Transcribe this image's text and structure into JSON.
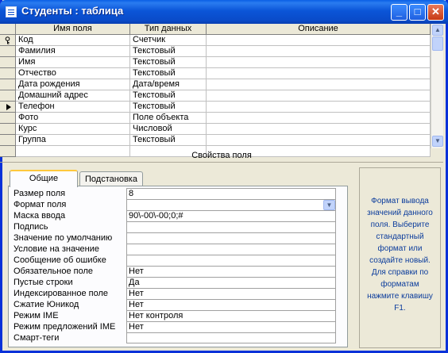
{
  "window": {
    "title": "Студенты : таблица",
    "minimize": "_",
    "maximize": "□",
    "close": "✕"
  },
  "grid": {
    "headers": [
      "Имя поля",
      "Тип данных",
      "Описание"
    ],
    "rows": [
      {
        "name": "Код",
        "type": "Счетчик",
        "desc": "",
        "marker": "key-icon"
      },
      {
        "name": "Фамилия",
        "type": "Текстовый",
        "desc": ""
      },
      {
        "name": "Имя",
        "type": "Текстовый",
        "desc": ""
      },
      {
        "name": "Отчество",
        "type": "Текстовый",
        "desc": ""
      },
      {
        "name": "Дата рождения",
        "type": "Дата/время",
        "desc": ""
      },
      {
        "name": "Домашний адрес",
        "type": "Текстовый",
        "desc": ""
      },
      {
        "name": "Телефон",
        "type": "Текстовый",
        "desc": "",
        "marker": "arrow-icon"
      },
      {
        "name": "Фото",
        "type": "Поле объекта",
        "desc": ""
      },
      {
        "name": "Курс",
        "type": "Числовой",
        "desc": ""
      },
      {
        "name": "Группа",
        "type": "Текстовый",
        "desc": ""
      }
    ]
  },
  "properties": {
    "label": "Свойства поля",
    "tabs": [
      "Общие",
      "Подстановка"
    ],
    "rows": [
      {
        "label": "Размер поля",
        "value": "8"
      },
      {
        "label": "Формат поля",
        "value": ""
      },
      {
        "label": "Маска ввода",
        "value": "90\\-00\\-00;0;#"
      },
      {
        "label": "Подпись",
        "value": ""
      },
      {
        "label": "Значение по умолчанию",
        "value": ""
      },
      {
        "label": "Условие на значение",
        "value": ""
      },
      {
        "label": "Сообщение об ошибке",
        "value": ""
      },
      {
        "label": "Обязательное поле",
        "value": "Нет"
      },
      {
        "label": "Пустые строки",
        "value": "Да"
      },
      {
        "label": "Индексированное поле",
        "value": "Нет"
      },
      {
        "label": "Сжатие Юникод",
        "value": "Нет"
      },
      {
        "label": "Режим IME",
        "value": "Нет контроля"
      },
      {
        "label": "Режим предложений IME",
        "value": "Нет"
      },
      {
        "label": "Смарт-теги",
        "value": ""
      }
    ]
  },
  "help": {
    "text": "Формат вывода значений данного поля. Выберите стандартный формат или создайте новый. Для справки по форматам нажмите клавишу F1."
  },
  "colors": {
    "titlebar": "#0a4bc9",
    "help_text": "#0b3c9c",
    "tab_highlight": "#ffc83c"
  }
}
